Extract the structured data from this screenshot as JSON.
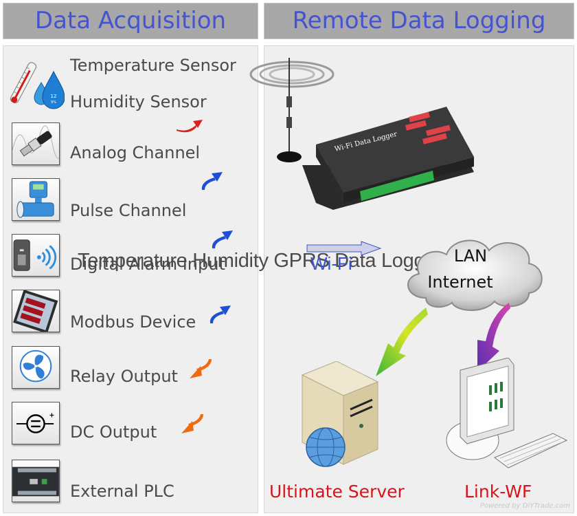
{
  "headers": {
    "left": "Data Acquisition",
    "right": "Remote Data Logging"
  },
  "acquisition_items": [
    {
      "label": "Temperature Sensor",
      "icon": "thermometer-icon"
    },
    {
      "label": "Humidity Sensor",
      "icon": "water-drop-icon"
    },
    {
      "label": "Analog Channel",
      "icon": "pressure-transmitter-icon"
    },
    {
      "label": "Pulse Channel",
      "icon": "flow-meter-icon"
    },
    {
      "label": "Digital Alarm Input",
      "icon": "wireless-detector-icon"
    },
    {
      "label": "Modbus Device",
      "icon": "panel-meter-icon"
    },
    {
      "label": "Relay Output",
      "icon": "fan-icon"
    },
    {
      "label": "DC Output",
      "icon": "dc-source-icon"
    },
    {
      "label": "External PLC",
      "icon": "plc-icon"
    }
  ],
  "arrow_colors": {
    "input_red": "#d8221c",
    "input_blue": "#1d4fd6",
    "output_orange": "#f06a10",
    "lan_green": "#7ccc2a",
    "lan_purple": "#a23bc4"
  },
  "device": {
    "name": "Wi-Fi Data Logger",
    "overlay_title": "Temperature Humidity GPRS Data Logger"
  },
  "link": {
    "wifi_label": "Wi-Fi"
  },
  "network": {
    "line1": "LAN",
    "line2": "Internet"
  },
  "endpoints": {
    "server": "Ultimate Server",
    "client": "Link-WF"
  },
  "watermark": "Powered by DIYTrade.com",
  "colors": {
    "header_bg": "#a8a8a8",
    "header_text": "#4653cf",
    "panel_bg": "#efefef",
    "endpoint_text": "#d6141c"
  }
}
